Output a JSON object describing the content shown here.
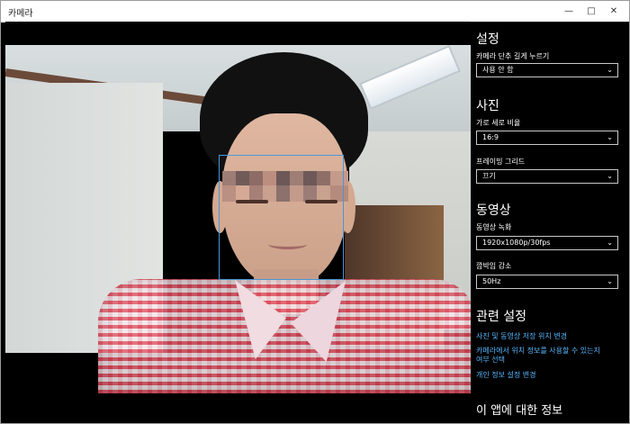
{
  "window": {
    "title": "카메라",
    "minimize_icon": "minimize-icon",
    "maximize_icon": "maximize-icon",
    "close_icon": "close-icon"
  },
  "settings": {
    "heading": "설정",
    "camera_hold_label": "카메라 단추 길게 누르기",
    "camera_hold_value": "사용 안 함",
    "photo_heading": "사진",
    "aspect_label": "가로 세로 비율",
    "aspect_value": "16:9",
    "grid_label": "프레이밍 그리드",
    "grid_value": "끄기",
    "video_heading": "동영상",
    "video_record_label": "동영상 녹화",
    "video_record_value": "1920x1080p/30fps",
    "flicker_label": "깜박임 감소",
    "flicker_value": "50Hz",
    "related_heading": "관련 설정",
    "link_photos_location": "사진 및 동영상 저장 위치 변경",
    "link_location_line1": "카메라에서 위치 정보를 사용할 수 있는지",
    "link_location_line2": "여부 선택",
    "link_privacy": "개인 정보 설정 변경",
    "about": "이 앱에 대한 정보"
  },
  "colors": {
    "panel_bg": "#000000",
    "accent_link": "#58b7ff",
    "face_box": "#4b96d8"
  }
}
